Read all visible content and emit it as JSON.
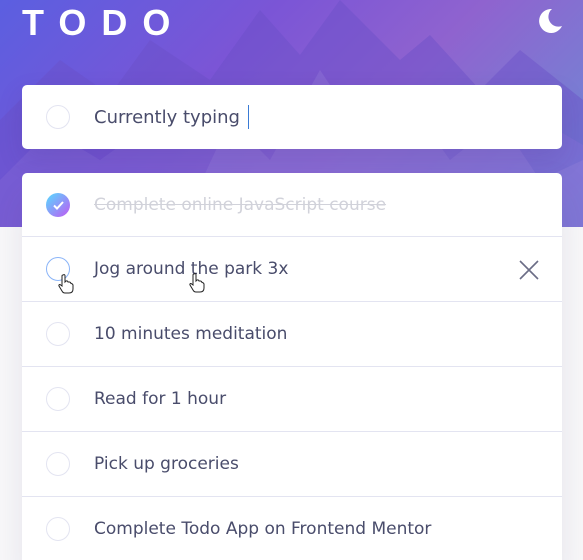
{
  "app": {
    "title": "TODO",
    "accent_start": "#55ddff",
    "accent_end": "#c058f3"
  },
  "header": {
    "theme_icon": "moon-icon"
  },
  "new_todo": {
    "value": "Currently typing"
  },
  "todos": [
    {
      "text": "Complete online JavaScript course",
      "completed": true
    },
    {
      "text": "Jog around the park 3x",
      "completed": false,
      "hovered": true
    },
    {
      "text": "10 minutes meditation",
      "completed": false
    },
    {
      "text": "Read for 1 hour",
      "completed": false
    },
    {
      "text": "Pick up groceries",
      "completed": false
    },
    {
      "text": "Complete Todo App on Frontend Mentor",
      "completed": false
    }
  ],
  "icons": {
    "check": "check-icon",
    "delete": "close-icon",
    "cursor": "hand-cursor-icon"
  }
}
